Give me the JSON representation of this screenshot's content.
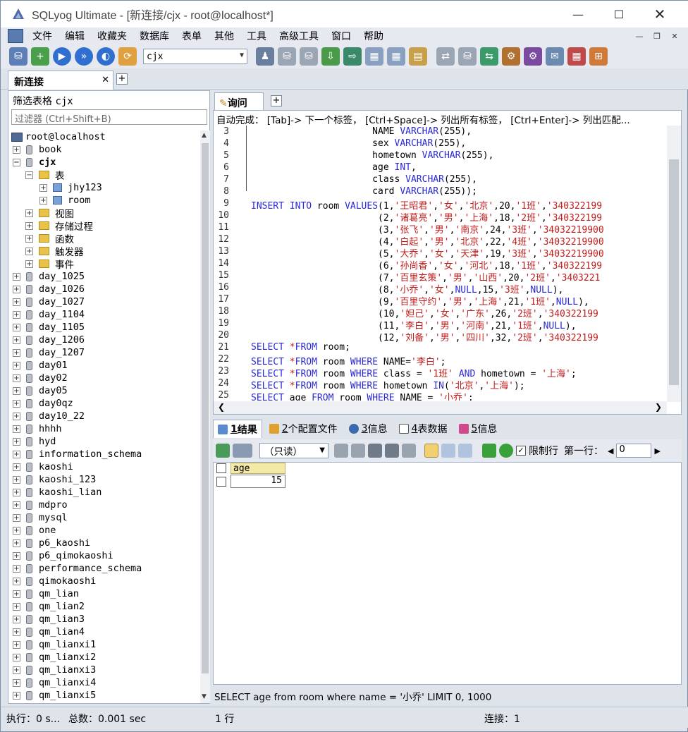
{
  "window": {
    "title": "SQLyog Ultimate - [新连接/cjx - root@localhost*]"
  },
  "menu": [
    "文件",
    "编辑",
    "收藏夹",
    "数据库",
    "表单",
    "其他",
    "工具",
    "高级工具",
    "窗口",
    "帮助"
  ],
  "toolbar": {
    "database_select": "cjx"
  },
  "connection_tab": {
    "label": "新连接",
    "close": "✕",
    "add": "+"
  },
  "filter": {
    "label": "筛选表格",
    "db": "cjx",
    "placeholder": "过滤器 (Ctrl+Shift+B)"
  },
  "tree": {
    "server": "root@localhost",
    "book": "book",
    "cjx": "cjx",
    "tables_folder": "表",
    "tables": [
      "jhy123",
      "room"
    ],
    "folders": [
      "视图",
      "存储过程",
      "函数",
      "触发器",
      "事件"
    ],
    "databases": [
      "day_1025",
      "day_1026",
      "day_1027",
      "day_1104",
      "day_1105",
      "day_1206",
      "day_1207",
      "day01",
      "day02",
      "day05",
      "day0qz",
      "day10_22",
      "hhhh",
      "hyd",
      "information_schema",
      "kaoshi",
      "kaoshi_123",
      "kaoshi_lian",
      "mdpro",
      "mysql",
      "one",
      "p6_kaoshi",
      "p6_qimokaoshi",
      "performance_schema",
      "qimokaoshi",
      "qm_lian",
      "qm_lian2",
      "qm_lian3",
      "qm_lian4",
      "qm_lianxi1",
      "qm_lianxi2",
      "qm_lianxi3",
      "qm_lianxi4",
      "qm_lianxi5"
    ]
  },
  "query_tab": {
    "label": "询问",
    "add": "+"
  },
  "editor": {
    "hint": "自动完成： [Tab]-> 下一个标签， [Ctrl+Space]-> 列出所有标签， [Ctrl+Enter]-> 列出匹配...",
    "lines": [
      {
        "n": "3",
        "t": "                      NAME VARCHAR(255),"
      },
      {
        "n": "4",
        "t": "                      sex VARCHAR(255),"
      },
      {
        "n": "5",
        "t": "                      hometown VARCHAR(255),"
      },
      {
        "n": "6",
        "t": "                      age INT,"
      },
      {
        "n": "7",
        "t": "                      class VARCHAR(255),"
      },
      {
        "n": "8",
        "t": "                      card VARCHAR(255));"
      },
      {
        "n": "9",
        "t": "INSERT INTO room VALUES(1,'王昭君','女','北京',20,'1班','340322199"
      },
      {
        "n": "10",
        "t": "                       (2,'诸葛亮','男','上海',18,'2班','340322199"
      },
      {
        "n": "11",
        "t": "                       (3,'张飞','男','南京',24,'3班','34032219900"
      },
      {
        "n": "12",
        "t": "                       (4,'白起','男','北京',22,'4班','34032219900"
      },
      {
        "n": "13",
        "t": "                       (5,'大乔','女','天津',19,'3班','34032219900"
      },
      {
        "n": "14",
        "t": "                       (6,'孙尚香','女','河北',18,'1班','340322199"
      },
      {
        "n": "15",
        "t": "                       (7,'百里玄策','男','山西',20,'2班','3403221"
      },
      {
        "n": "16",
        "t": "                       (8,'小乔','女',NULL,15,'3班',NULL),"
      },
      {
        "n": "17",
        "t": "                       (9,'百里守约','男','上海',21,'1班',NULL),"
      },
      {
        "n": "18",
        "t": "                       (10,'妲己','女','广东',26,'2班','340322199"
      },
      {
        "n": "19",
        "t": "                       (11,'李白','男','河南',21,'1班',NULL),"
      },
      {
        "n": "20",
        "t": "                       (12,'刘备','男','四川',32,'2班','340322199"
      },
      {
        "n": "21",
        "t": "SELECT *FROM room;"
      },
      {
        "n": "22",
        "t": "SELECT *FROM room WHERE NAME='李白';"
      },
      {
        "n": "23",
        "t": "SELECT *FROM room WHERE class = '1班' AND hometown = '上海';"
      },
      {
        "n": "24",
        "t": "SELECT *FROM room WHERE hometown IN('北京','上海');"
      },
      {
        "n": "25",
        "t": "SELECT age FROM room WHERE NAME = '小乔';"
      }
    ]
  },
  "result_tabs": [
    {
      "num": "1",
      "label": " 结果"
    },
    {
      "num": "2",
      "label": " 个配置文件"
    },
    {
      "num": "3",
      "label": " 信息"
    },
    {
      "num": "4",
      "label": " 表数据"
    },
    {
      "num": "5",
      "label": " 信息"
    }
  ],
  "result_toolbar": {
    "mode": "（只读）",
    "limit_label": "限制行",
    "first_row_label": "第一行：",
    "first_row_value": "0"
  },
  "grid": {
    "columns": [
      "age"
    ],
    "rows": [
      [
        "15"
      ]
    ]
  },
  "sql_bar": "SELECT age from room where name = '小乔' LIMIT 0, 1000",
  "status": {
    "exec": "执行：0 s...",
    "total": "总数：0.001 sec",
    "rows": "1 行",
    "conn": "连接：1"
  }
}
